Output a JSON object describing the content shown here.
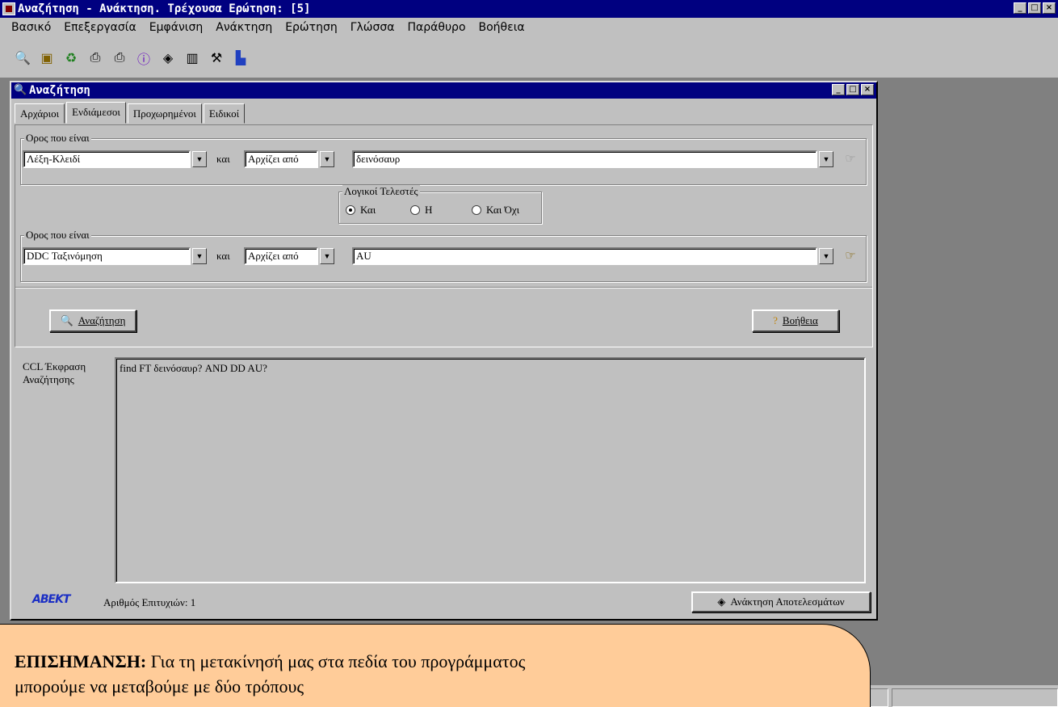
{
  "window": {
    "title": "Αναζήτηση - Ανάκτηση. Τρέχουσα Ερώτηση: [5]"
  },
  "menu": [
    "Βασικό",
    "Επεξεργασία",
    "Εμφάνιση",
    "Ανάκτηση",
    "Ερώτηση",
    "Γλώσσα",
    "Παράθυρο",
    "Βοήθεια"
  ],
  "toolbar_icons": [
    "search-tool-icon",
    "copy-tool-icon",
    "clear-tool-icon",
    "print-tool-icon",
    "print-preview-icon",
    "info-icon",
    "retrieve-icon",
    "barcode-icon",
    "tools-icon",
    "chart-icon"
  ],
  "child": {
    "title": "Αναζήτηση",
    "tabs": [
      "Αρχάριοι",
      "Ενδιάμεσοι",
      "Προχωρημένοι",
      "Ειδικοί"
    ],
    "active_tab": "Ενδιάμεσοι",
    "term1": {
      "group_label": "Ορος που είναι",
      "field": "Λέξη-Κλειδί",
      "connector": "και",
      "mode": "Αρχίζει από",
      "value": "δεινόσαυρ"
    },
    "logical": {
      "label": "Λογικοί Τελεστές",
      "options": [
        "Και",
        "Η",
        "Και Όχι"
      ],
      "selected": "Και"
    },
    "term2": {
      "group_label": "Ορος που είναι",
      "field": "DDC Ταξινόμηση",
      "connector": "και",
      "mode": "Αρχίζει από",
      "value": "AU"
    },
    "search_button": "Αναζήτηση",
    "help_button": "Βοήθεια",
    "ccl_label_1": "CCL Έκφραση",
    "ccl_label_2": "Αναζήτησης",
    "ccl_text": "find FT δεινόσαυρ? AND DD AU?",
    "status": {
      "logo": "ABEKT",
      "hits_label": "Αριθμός Επιτυχιών:",
      "hits_value": "1",
      "retrieve_button": "Ανάκτηση Αποτελεσμάτων"
    }
  },
  "note": {
    "bold": "ΕΠΙΣΗΜΑΝΣΗ:",
    "line1": " Για τη μετακίνησή μας στα πεδία του προγράμματος",
    "line2": "μπορούμε να μεταβούμε με δύο τρόπους"
  }
}
